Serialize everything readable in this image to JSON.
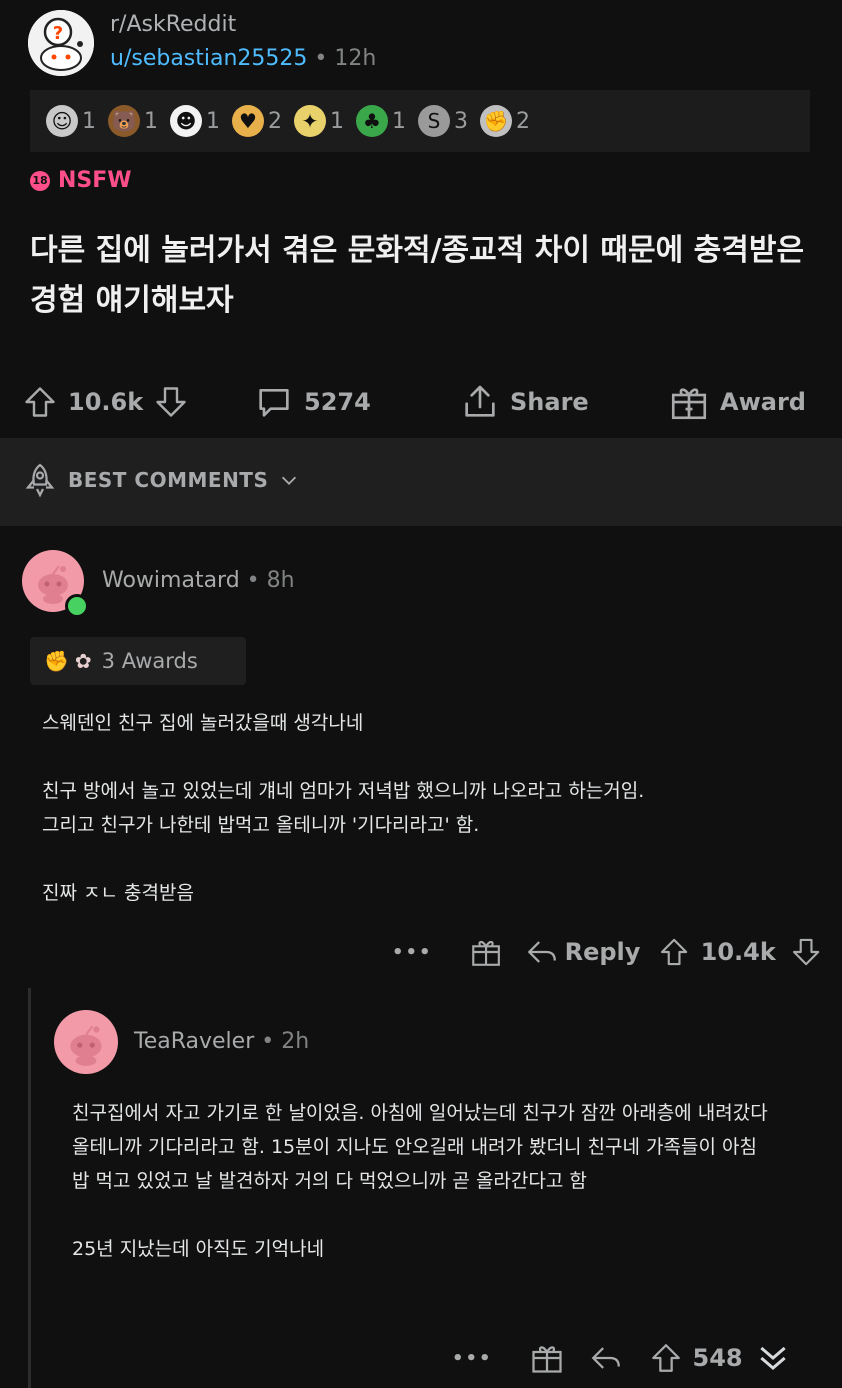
{
  "post": {
    "subreddit": "r/AskReddit",
    "author": "u/sebastian25525",
    "separator": "•",
    "age": "12h",
    "awards": [
      {
        "icon": "silver-award-icon",
        "count": "1",
        "color": "#c9c9c9"
      },
      {
        "icon": "bear-award-icon",
        "count": "1",
        "color": "#8b5a2b"
      },
      {
        "icon": "snoo-award-icon",
        "count": "1",
        "color": "#f2f2f2"
      },
      {
        "icon": "heart-hands-award-icon",
        "count": "2",
        "color": "#e8b04a"
      },
      {
        "icon": "party-award-icon",
        "count": "1",
        "color": "#e8d06a"
      },
      {
        "icon": "dino-award-icon",
        "count": "1",
        "color": "#3aa84a"
      },
      {
        "icon": "s-award-icon",
        "count": "3",
        "color": "#9a9a9a"
      },
      {
        "icon": "helping-hand-award-icon",
        "count": "2",
        "color": "#c0c0c0"
      }
    ],
    "nsfw_badge": "18",
    "nsfw_label": "NSFW",
    "title": "다른 집에 놀러가서 겪은 문화적/종교적 차이 때문에 충격받은 경험 얘기해보자",
    "upvotes": "10.6k",
    "comments": "5274",
    "share_label": "Share",
    "award_label": "Award"
  },
  "sort": {
    "label": "BEST COMMENTS"
  },
  "comment1": {
    "author": "Wowimatard",
    "separator": "•",
    "age": "8h",
    "awards_label": "3 Awards",
    "body": "스웨덴인 친구 집에 놀러갔을때 생각나네\n\n친구 방에서 놀고 있었는데 걔네 엄마가 저녁밥 했으니까 나오라고 하는거임.\n그리고 친구가 나한테 밥먹고 올테니까 '기다리라고' 함.\n\n진짜 ㅈㄴ 충격받음",
    "more": "•••",
    "reply_label": "Reply",
    "score": "10.4k"
  },
  "comment2": {
    "author": "TeaRaveler",
    "separator": "•",
    "age": "2h",
    "body": "친구집에서 자고 가기로 한 날이었음. 아침에 일어났는데 친구가 잠깐 아래층에 내려갔다\n올테니까 기다리라고 함. 15분이 지나도 안오길래 내려가 봤더니 친구네 가족들이 아침\n밥 먹고 있었고 날 발견하자 거의 다 먹었으니까 곧 올라간다고 함\n\n25년 지났는데 아직도 기억나네",
    "more": "•••",
    "score": "548"
  },
  "colors": {
    "background": "#101010",
    "nsfw": "#ff4f8b",
    "username_link": "#4fbcff",
    "online": "#46d160",
    "avatar": "#f29aa8"
  }
}
